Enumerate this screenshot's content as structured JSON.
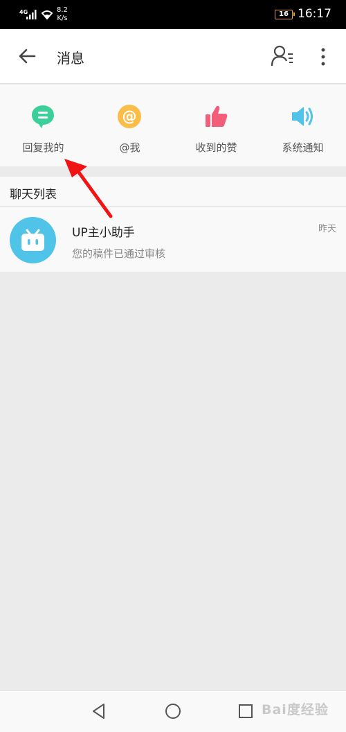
{
  "status_bar": {
    "network": "4G",
    "speed_value": "8.2",
    "speed_unit": "K/s",
    "battery": "16",
    "time": "16:17"
  },
  "app_bar": {
    "title": "消息",
    "back_icon": "arrow-left-icon",
    "contacts_icon": "contacts-list-icon",
    "more_icon": "more-vertical-icon"
  },
  "quick_actions": [
    {
      "label": "回复我的",
      "icon": "chat-bubble-icon",
      "color": "#3dcf9a"
    },
    {
      "label": "@我",
      "icon": "at-sign-icon",
      "color": "#f9bd48"
    },
    {
      "label": "收到的赞",
      "icon": "thumbs-up-icon",
      "color": "#f25d7a"
    },
    {
      "label": "系统通知",
      "icon": "speaker-icon",
      "color": "#4fc3e8"
    }
  ],
  "chat_list": {
    "header": "聊天列表",
    "items": [
      {
        "name": "UP主小助手",
        "preview": "您的稿件已通过审核",
        "time": "昨天",
        "avatar_icon": "bilibili-tv-icon",
        "avatar_color": "#4fc3e8"
      }
    ]
  },
  "annotation": {
    "color": "#f01414",
    "icon": "red-arrow-icon"
  },
  "nav_bar": {
    "back_icon": "triangle-back-icon",
    "home_icon": "circle-home-icon",
    "recent_icon": "square-recent-icon"
  },
  "watermark": {
    "text": "Bai度经验"
  }
}
